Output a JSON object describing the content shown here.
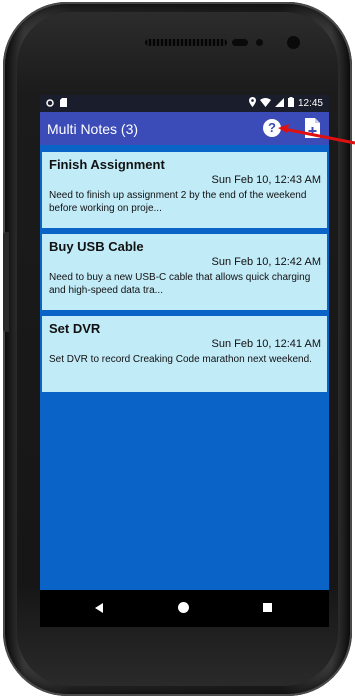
{
  "status_bar": {
    "time": "12:45"
  },
  "app_bar": {
    "title": "Multi Notes (3)",
    "help_label": "?"
  },
  "notes": [
    {
      "title": "Finish Assignment",
      "date": "Sun Feb 10, 12:43 AM",
      "text": "Need to finish up assignment 2 by the end of the weekend before working on proje..."
    },
    {
      "title": "Buy USB Cable",
      "date": "Sun Feb 10, 12:42 AM",
      "text": "Need to buy a new USB-C cable that allows quick charging and high-speed data tra..."
    },
    {
      "title": "Set DVR",
      "date": "Sun Feb 10, 12:41 AM",
      "text": "Set DVR to record Creaking Code marathon next weekend."
    }
  ],
  "icons": {
    "help": "help-icon",
    "add_note": "add-note-icon",
    "back": "back-icon",
    "home": "home-icon",
    "recents": "recents-icon"
  },
  "colors": {
    "app_bar": "#3b4bb8",
    "background": "#0a63c7",
    "note_card": "#c2ebf8",
    "status_bar": "#1a1d2c",
    "annotation_arrow": "#e01010"
  }
}
